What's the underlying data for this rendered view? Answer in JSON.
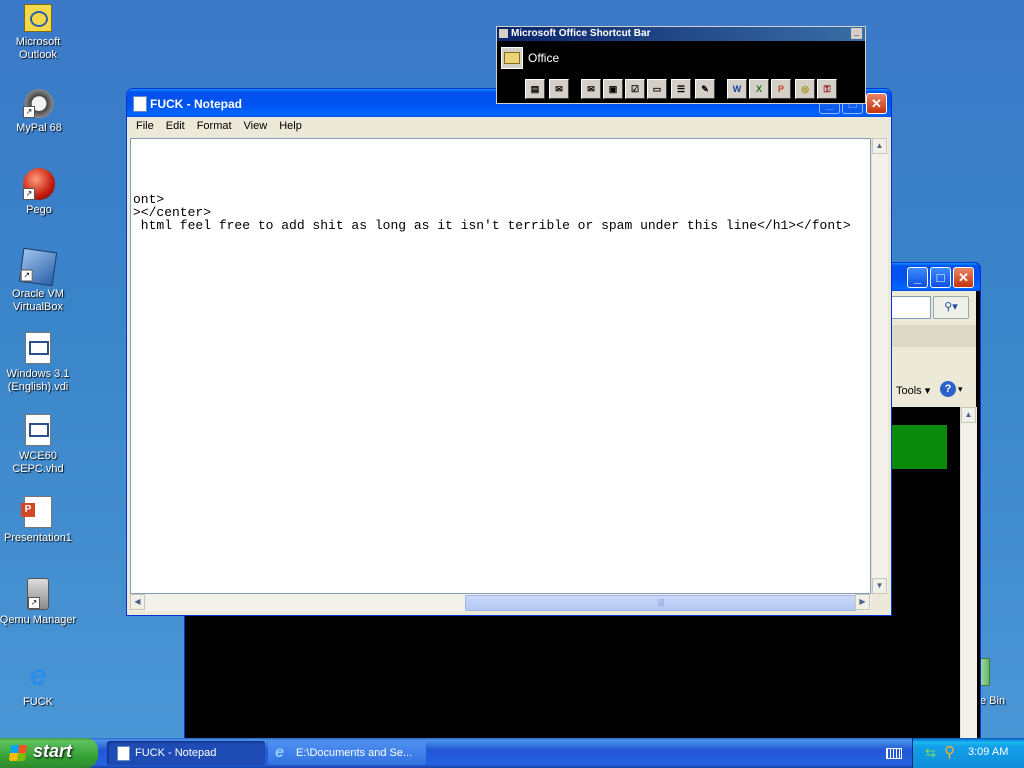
{
  "desktop": {
    "icons": [
      {
        "label": "Microsoft Outlook"
      },
      {
        "label": "MyPal 68"
      },
      {
        "label": "Pego"
      },
      {
        "label": "Oracle VM VirtualBox"
      },
      {
        "label": "Windows 3.1 (English).vdi"
      },
      {
        "label": "WCE60 CEPC.vhd"
      },
      {
        "label": "Presentation1"
      },
      {
        "label": "Qemu Manager"
      },
      {
        "label": "FUCK"
      }
    ],
    "recycle_partial_label": "e Bin"
  },
  "office_bar": {
    "title": "Microsoft Office Shortcut Bar",
    "folder_label": "Office"
  },
  "notepad": {
    "title": "FUCK - Notepad",
    "menu": [
      "File",
      "Edit",
      "Format",
      "View",
      "Help"
    ],
    "lines": [
      "ont>",
      "></center>",
      " html feel free to add shit as long as it isn't terrible or spam under this line</h1></font>"
    ]
  },
  "background_window": {
    "tools_label": "Tools",
    "accent_color": "#0a8a0a"
  },
  "taskbar": {
    "start_label": "start",
    "tasks": [
      {
        "label": "FUCK - Notepad"
      },
      {
        "label": "E:\\Documents and Se..."
      }
    ],
    "clock": "3:09 AM"
  },
  "colors": {
    "xp_blue": "#0053ee",
    "desktop": "#3a84c9",
    "taskbar": "#2157d7"
  }
}
